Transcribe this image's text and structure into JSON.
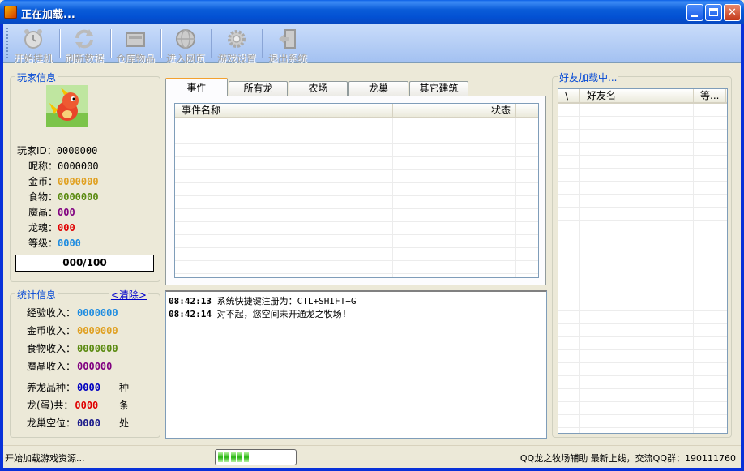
{
  "window": {
    "title": "正在加载..."
  },
  "toolbar": {
    "buttons": [
      {
        "label": "开始挂机",
        "icon": "alarm-clock-icon"
      },
      {
        "label": "刷新数据",
        "icon": "refresh-icon"
      },
      {
        "label": "仓库物品",
        "icon": "storage-box-icon"
      },
      {
        "label": "进入网页",
        "icon": "globe-icon"
      },
      {
        "label": "游戏设置",
        "icon": "gear-icon"
      },
      {
        "label": "退出系统",
        "icon": "exit-door-icon"
      }
    ]
  },
  "player": {
    "group_title": "玩家信息",
    "id_label": "玩家ID：",
    "id_value": "0000000",
    "nick_label": "昵称：",
    "nick_value": "0000000",
    "gold_label": "金币：",
    "gold_value": "0000000",
    "food_label": "食物：",
    "food_value": "0000000",
    "crystal_label": "魔晶：",
    "crystal_value": "000",
    "soul_label": "龙魂：",
    "soul_value": "000",
    "level_label": "等级：",
    "level_value": "0000",
    "exp_text": "000/100"
  },
  "stats": {
    "group_title": "统计信息",
    "clear_label": "<清除>",
    "exp_income_label": "经验收入：",
    "exp_income_value": "0000000",
    "gold_income_label": "金币收入：",
    "gold_income_value": "0000000",
    "food_income_label": "食物收入：",
    "food_income_value": "0000000",
    "crystal_income_label": "魔晶收入：",
    "crystal_income_value": "000000",
    "breed_label": "养龙品种：",
    "breed_value": "0000",
    "breed_unit": "种",
    "dragon_label": "龙(蛋)共：",
    "dragon_value": "0000",
    "dragon_unit": "条",
    "nest_label": "龙巢空位：",
    "nest_value": "0000",
    "nest_unit": "处"
  },
  "tabs": [
    "事件",
    "所有龙",
    "农场",
    "龙巢",
    "其它建筑"
  ],
  "events_table": {
    "columns": [
      "事件名称",
      "状态"
    ]
  },
  "log": [
    {
      "time": "08:42:13",
      "text": "系统快捷键注册为：CTL+SHIFT+G"
    },
    {
      "time": "08:42:14",
      "text": "对不起，您空间未开通龙之牧场!"
    }
  ],
  "friends": {
    "group_title": "好友加载中...",
    "columns": [
      "\\",
      "好友名",
      "等..."
    ]
  },
  "status": {
    "left": "开始加载游戏资源...",
    "progress": 0.45,
    "right": "QQ龙之牧场辅助 最新上线，交流QQ群：190111760"
  },
  "colors": {
    "gold": "#e0a020",
    "food": "#5a8a10",
    "crystal": "#800080",
    "soul": "#e00000",
    "level": "#1e8ce0",
    "exp_income": "#1e8ce0",
    "breed": "#0000c0",
    "dragon": "#e00000",
    "nest": "#1a1a8a",
    "accent": "#0046d5"
  }
}
